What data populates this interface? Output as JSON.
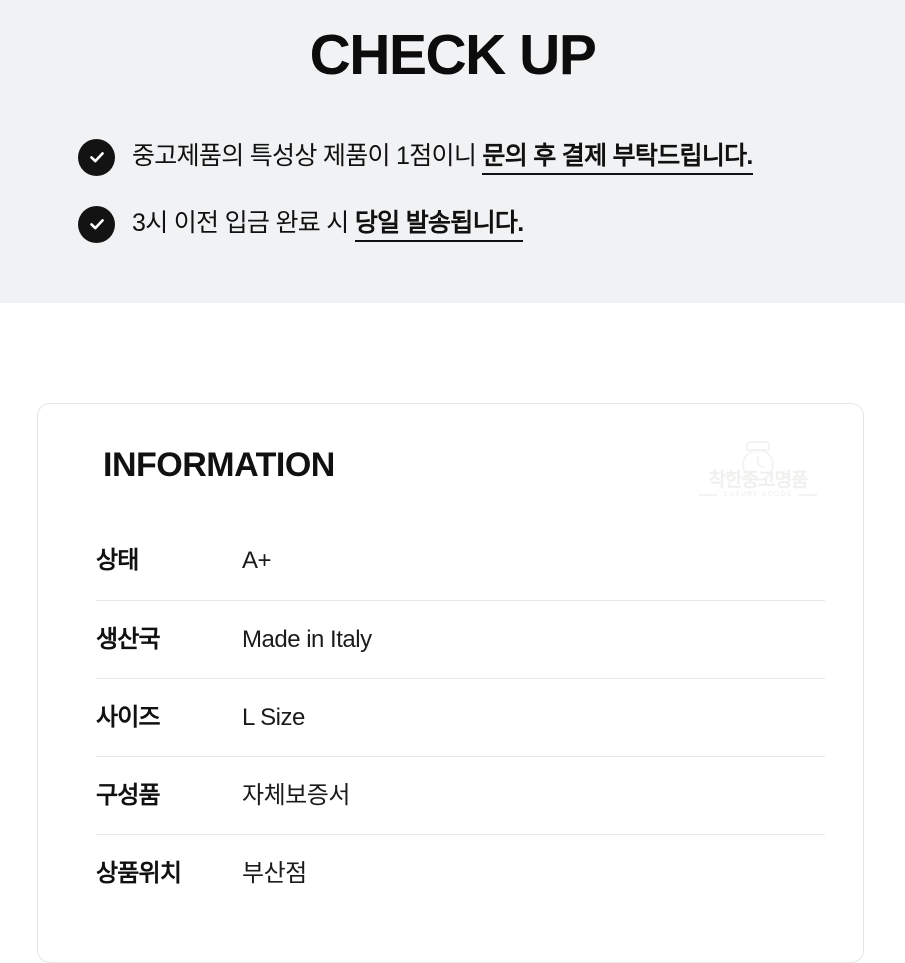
{
  "checkup": {
    "title": "CHECK UP",
    "items": [
      {
        "icon": "check-circle-icon",
        "text_plain": "중고제품의 특성상 제품이 1점이니 ",
        "text_emphasis": "문의 후 결제 부탁드립니다."
      },
      {
        "icon": "check-circle-icon",
        "text_plain": "3시 이전 입금 완료 시 ",
        "text_emphasis": "당일 발송됩니다."
      }
    ]
  },
  "information": {
    "heading": "INFORMATION",
    "watermark": {
      "icon": "watch-icon",
      "brand_kr": "착한중고명품",
      "brand_en": "LUXURY GOODS"
    },
    "rows": [
      {
        "label": "상태",
        "value": "A+"
      },
      {
        "label": "생산국",
        "value": "Made in Italy"
      },
      {
        "label": "사이즈",
        "value": "L Size"
      },
      {
        "label": "구성품",
        "value": "자체보증서"
      },
      {
        "label": "상품위치",
        "value": "부산점"
      }
    ]
  },
  "colors": {
    "band_background": "#f1f2f4",
    "page_background": "#ffffff",
    "text_primary": "#111111",
    "icon_fill": "#131313",
    "card_border": "#e6e6e6",
    "row_divider": "#e8e8e8",
    "watermark": "#f0f0ee"
  }
}
